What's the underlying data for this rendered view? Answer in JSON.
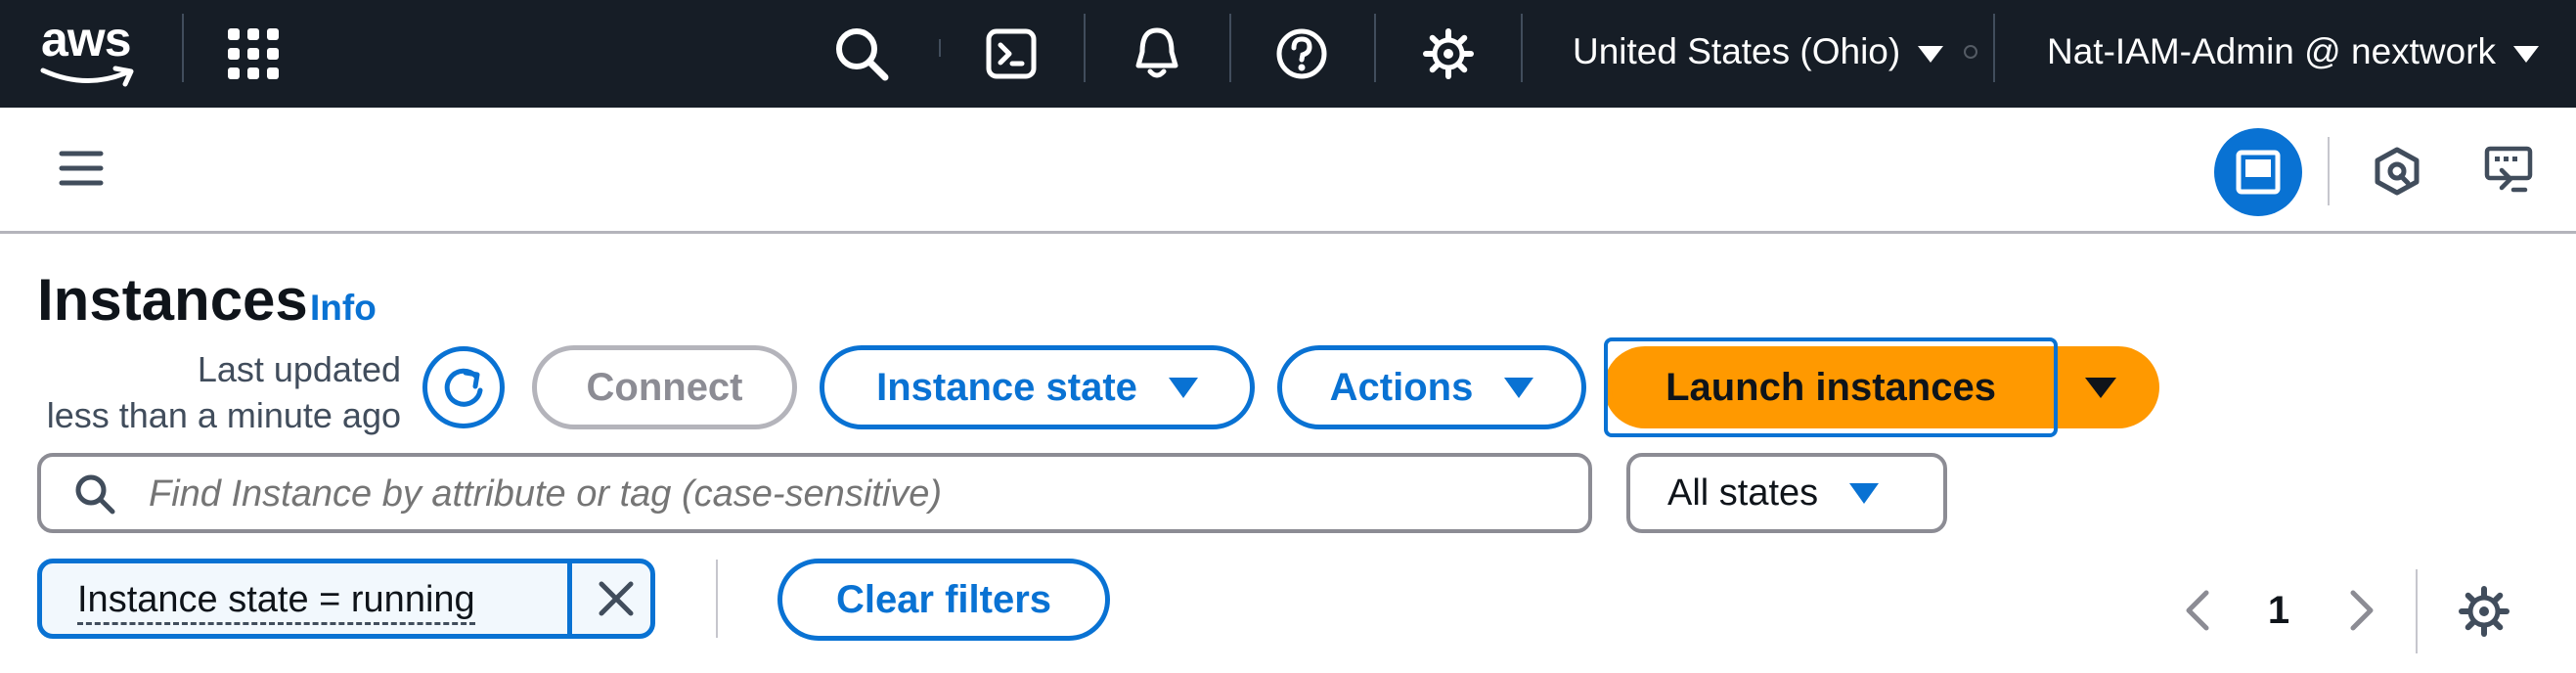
{
  "topnav": {
    "logo_text": "aws",
    "region": "United States (Ohio)",
    "account": "Nat-IAM-Admin @ nextwork",
    "icons": [
      "grid-icon",
      "search-icon",
      "cloudshell-icon",
      "bell-icon",
      "help-icon",
      "gear-icon"
    ]
  },
  "subbar": {
    "icons": [
      "hamburger-icon",
      "panel-icon",
      "security-icon",
      "feedback-icon"
    ]
  },
  "page": {
    "title": "Instances",
    "info_link": "Info",
    "last_updated_line1": "Last updated",
    "last_updated_line2": "less than a minute ago"
  },
  "actions": {
    "connect": "Connect",
    "instance_state": "Instance state",
    "actions": "Actions",
    "launch": "Launch instances"
  },
  "search": {
    "placeholder": "Find Instance by attribute or tag (case-sensitive)",
    "value": ""
  },
  "state_filter": {
    "selected": "All states"
  },
  "filters": {
    "token": "Instance state = running",
    "clear_label": "Clear filters"
  },
  "pagination": {
    "current_page": "1"
  },
  "colors": {
    "nav_bg": "#161d26",
    "accent": "#0972d3",
    "launch": "#ff9900",
    "token_bg": "#f2f8fd"
  }
}
